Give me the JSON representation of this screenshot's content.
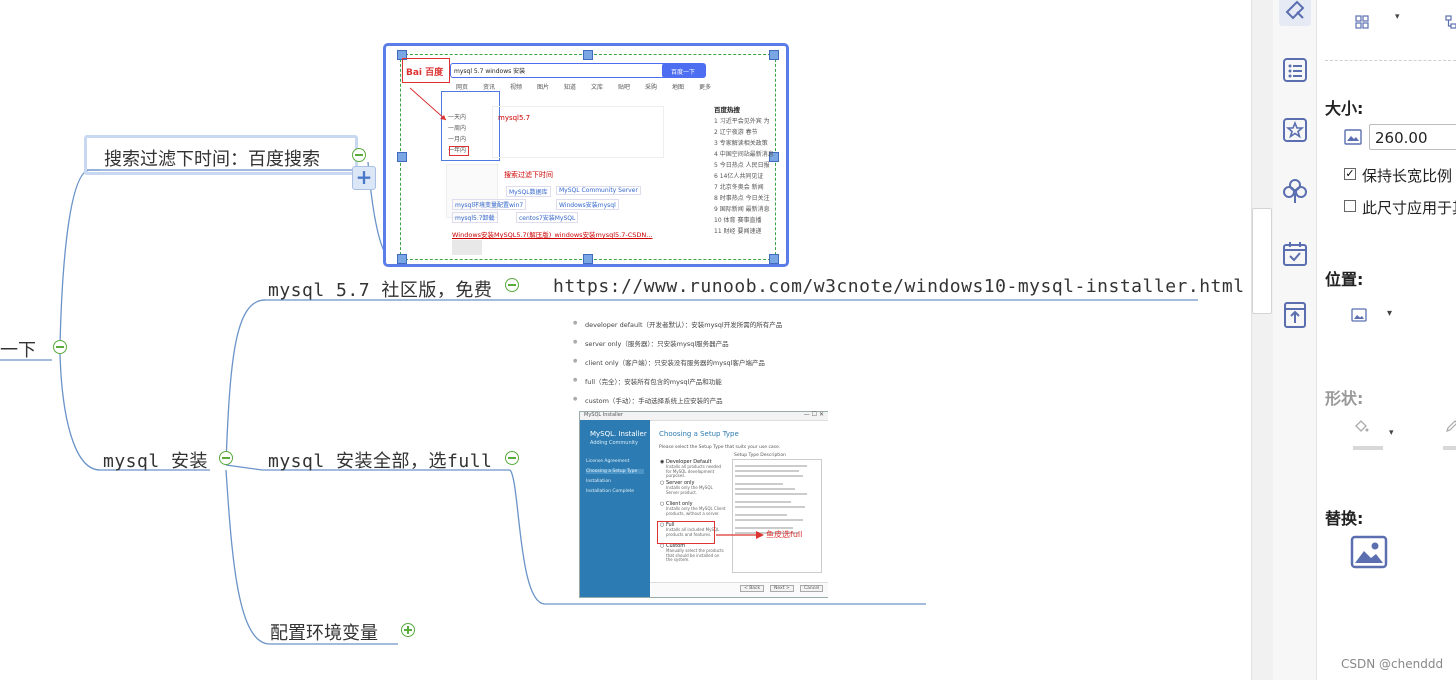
{
  "mindmap": {
    "root_partial": "一下",
    "node_search_filter": "搜索过滤下时间：百度搜索",
    "node_mysql57": "mysql 5.7 社区版，免费",
    "node_runoob_url": "https://www.runoob.com/w3cnote/windows10-mysql-installer.html",
    "node_mysql_install": "mysql 安装",
    "node_install_all": "mysql 安装全部，选full",
    "node_env": "配置环境变量",
    "add_button": "+"
  },
  "image1": {
    "logo": "Bai 百度",
    "search_query": "mysql 5.7 windows 安装",
    "search_button": "百度一下",
    "tabs": [
      "网页",
      "资讯",
      "视频",
      "图片",
      "知道",
      "文库",
      "贴吧",
      "采购",
      "地图",
      "更多"
    ],
    "filter_items": [
      "一天内",
      "一周内",
      "一月内",
      "一年内"
    ],
    "annotation": "搜索过滤下时间",
    "result_title": "Windows安装MySQL5.7(解压版)_windows安装mysql5.7-CSDN...",
    "hot_title": "百度热搜",
    "chips": [
      "MySQL数据库",
      "MySQL Community Server",
      "mysql环境变量配置win7",
      "Windows安装mysql",
      "mysql5.7卸载",
      "centos7安装MySQL"
    ],
    "hot_list": [
      "习近平会见外宾 为",
      "辽宁夜游 春节",
      "专家解读相关政策",
      "中国空间站最新消息",
      "今日热点 人民日报",
      "14亿人共同见证",
      "北京冬奥会 新闻",
      "时事热点 今日关注",
      "国际新闻 最新消息",
      "体育 赛事直播",
      "财经 要闻速递"
    ]
  },
  "image2": {
    "bullets": [
      "developer default（开发者默认）：安装mysql开发所需的所有产品",
      "server only（服务器）：只安装mysql服务器产品",
      "client only（客户端）：只安装没有服务器的mysql客户端产品",
      "full（完全）：安装所有包含的mysql产品和功能",
      "custom（手动）：手动选择系统上应安装的产品"
    ],
    "window_title": "MySQL Installer",
    "window_brand": "MySQL. Installer",
    "window_subtitle": "Adding Community",
    "sidebar_steps": [
      "License Agreement",
      "Choosing a Setup Type",
      "Installation",
      "Installation Complete"
    ],
    "heading": "Choosing a Setup Type",
    "instruction": "Please select the Setup Type that suits your use case.",
    "options": [
      {
        "name": "Developer Default",
        "desc": "Installs all products needed for MySQL development purposes."
      },
      {
        "name": "Server only",
        "desc": "Installs only the MySQL Server product."
      },
      {
        "name": "Client only",
        "desc": "Installs only the MySQL Client products, without a server."
      },
      {
        "name": "Full",
        "desc": "Installs all included MySQL products and features."
      },
      {
        "name": "Custom",
        "desc": "Manually select the products that should be installed on the system."
      }
    ],
    "desc_title": "Setup Type Description",
    "annotation": "鱼皮选full",
    "buttons": [
      "< Back",
      "Next >",
      "Cancel"
    ]
  },
  "panel": {
    "size_label": "大小:",
    "width_value": "260.00",
    "keep_ratio_label": "保持长宽比例",
    "keep_ratio_checked": true,
    "apply_label": "此尺寸应用于其",
    "position_label": "位置:",
    "shape_label": "形状:",
    "replace_label": "替换:"
  },
  "watermark": "CSDN @chenddd",
  "colors": {
    "accent": "#5b7de8",
    "toggle": "#5aab3e",
    "line": "#6a8fc9",
    "icon": "#5b6fb0"
  }
}
